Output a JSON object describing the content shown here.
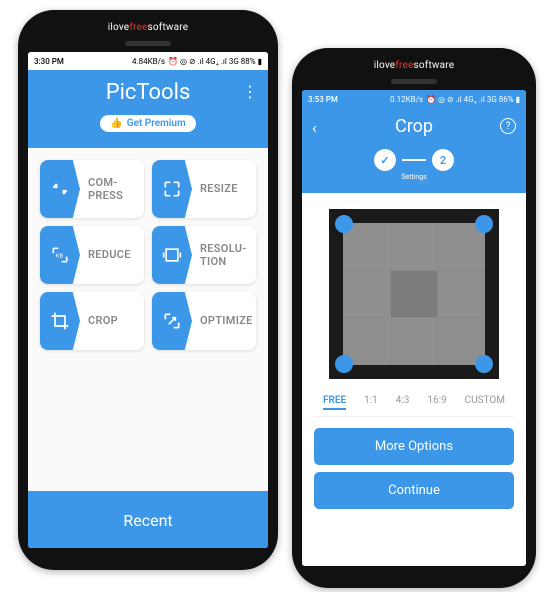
{
  "watermark": {
    "pre": "ilove",
    "mid": "free",
    "post": "software"
  },
  "phoneLeft": {
    "status": {
      "time": "3:30 PM",
      "net": "4.84KB/s",
      "extra": "⏰ ◎ ⊘ .ıl 4G₊ .ıl 3G 88% ▮"
    },
    "header": {
      "title": "PicTools",
      "premium": "Get Premium",
      "premiumIcon": "👍"
    },
    "tools": [
      {
        "label": "COM-\nPRESS",
        "icon": "compress"
      },
      {
        "label": "RESIZE",
        "icon": "resize"
      },
      {
        "label": "REDUCE",
        "icon": "reduce"
      },
      {
        "label": "RESOLU-\nTION",
        "icon": "resolution"
      },
      {
        "label": "CROP",
        "icon": "crop"
      },
      {
        "label": "OPTIMIZE",
        "icon": "optimize"
      }
    ],
    "recent": "Recent"
  },
  "phoneRight": {
    "status": {
      "time": "3:53 PM",
      "net": "0.12KB/s",
      "extra": "⏰ ◎ ⊘ .ıl 4G₊ .ıl 3G 86% ▮"
    },
    "header": {
      "title": "Crop",
      "stepLabel": "Settings",
      "step2": "2"
    },
    "ratios": [
      "FREE",
      "1:1",
      "4:3",
      "16:9",
      "CUSTOM"
    ],
    "selectedRatio": 0,
    "buttons": {
      "more": "More Options",
      "continue": "Continue"
    }
  }
}
